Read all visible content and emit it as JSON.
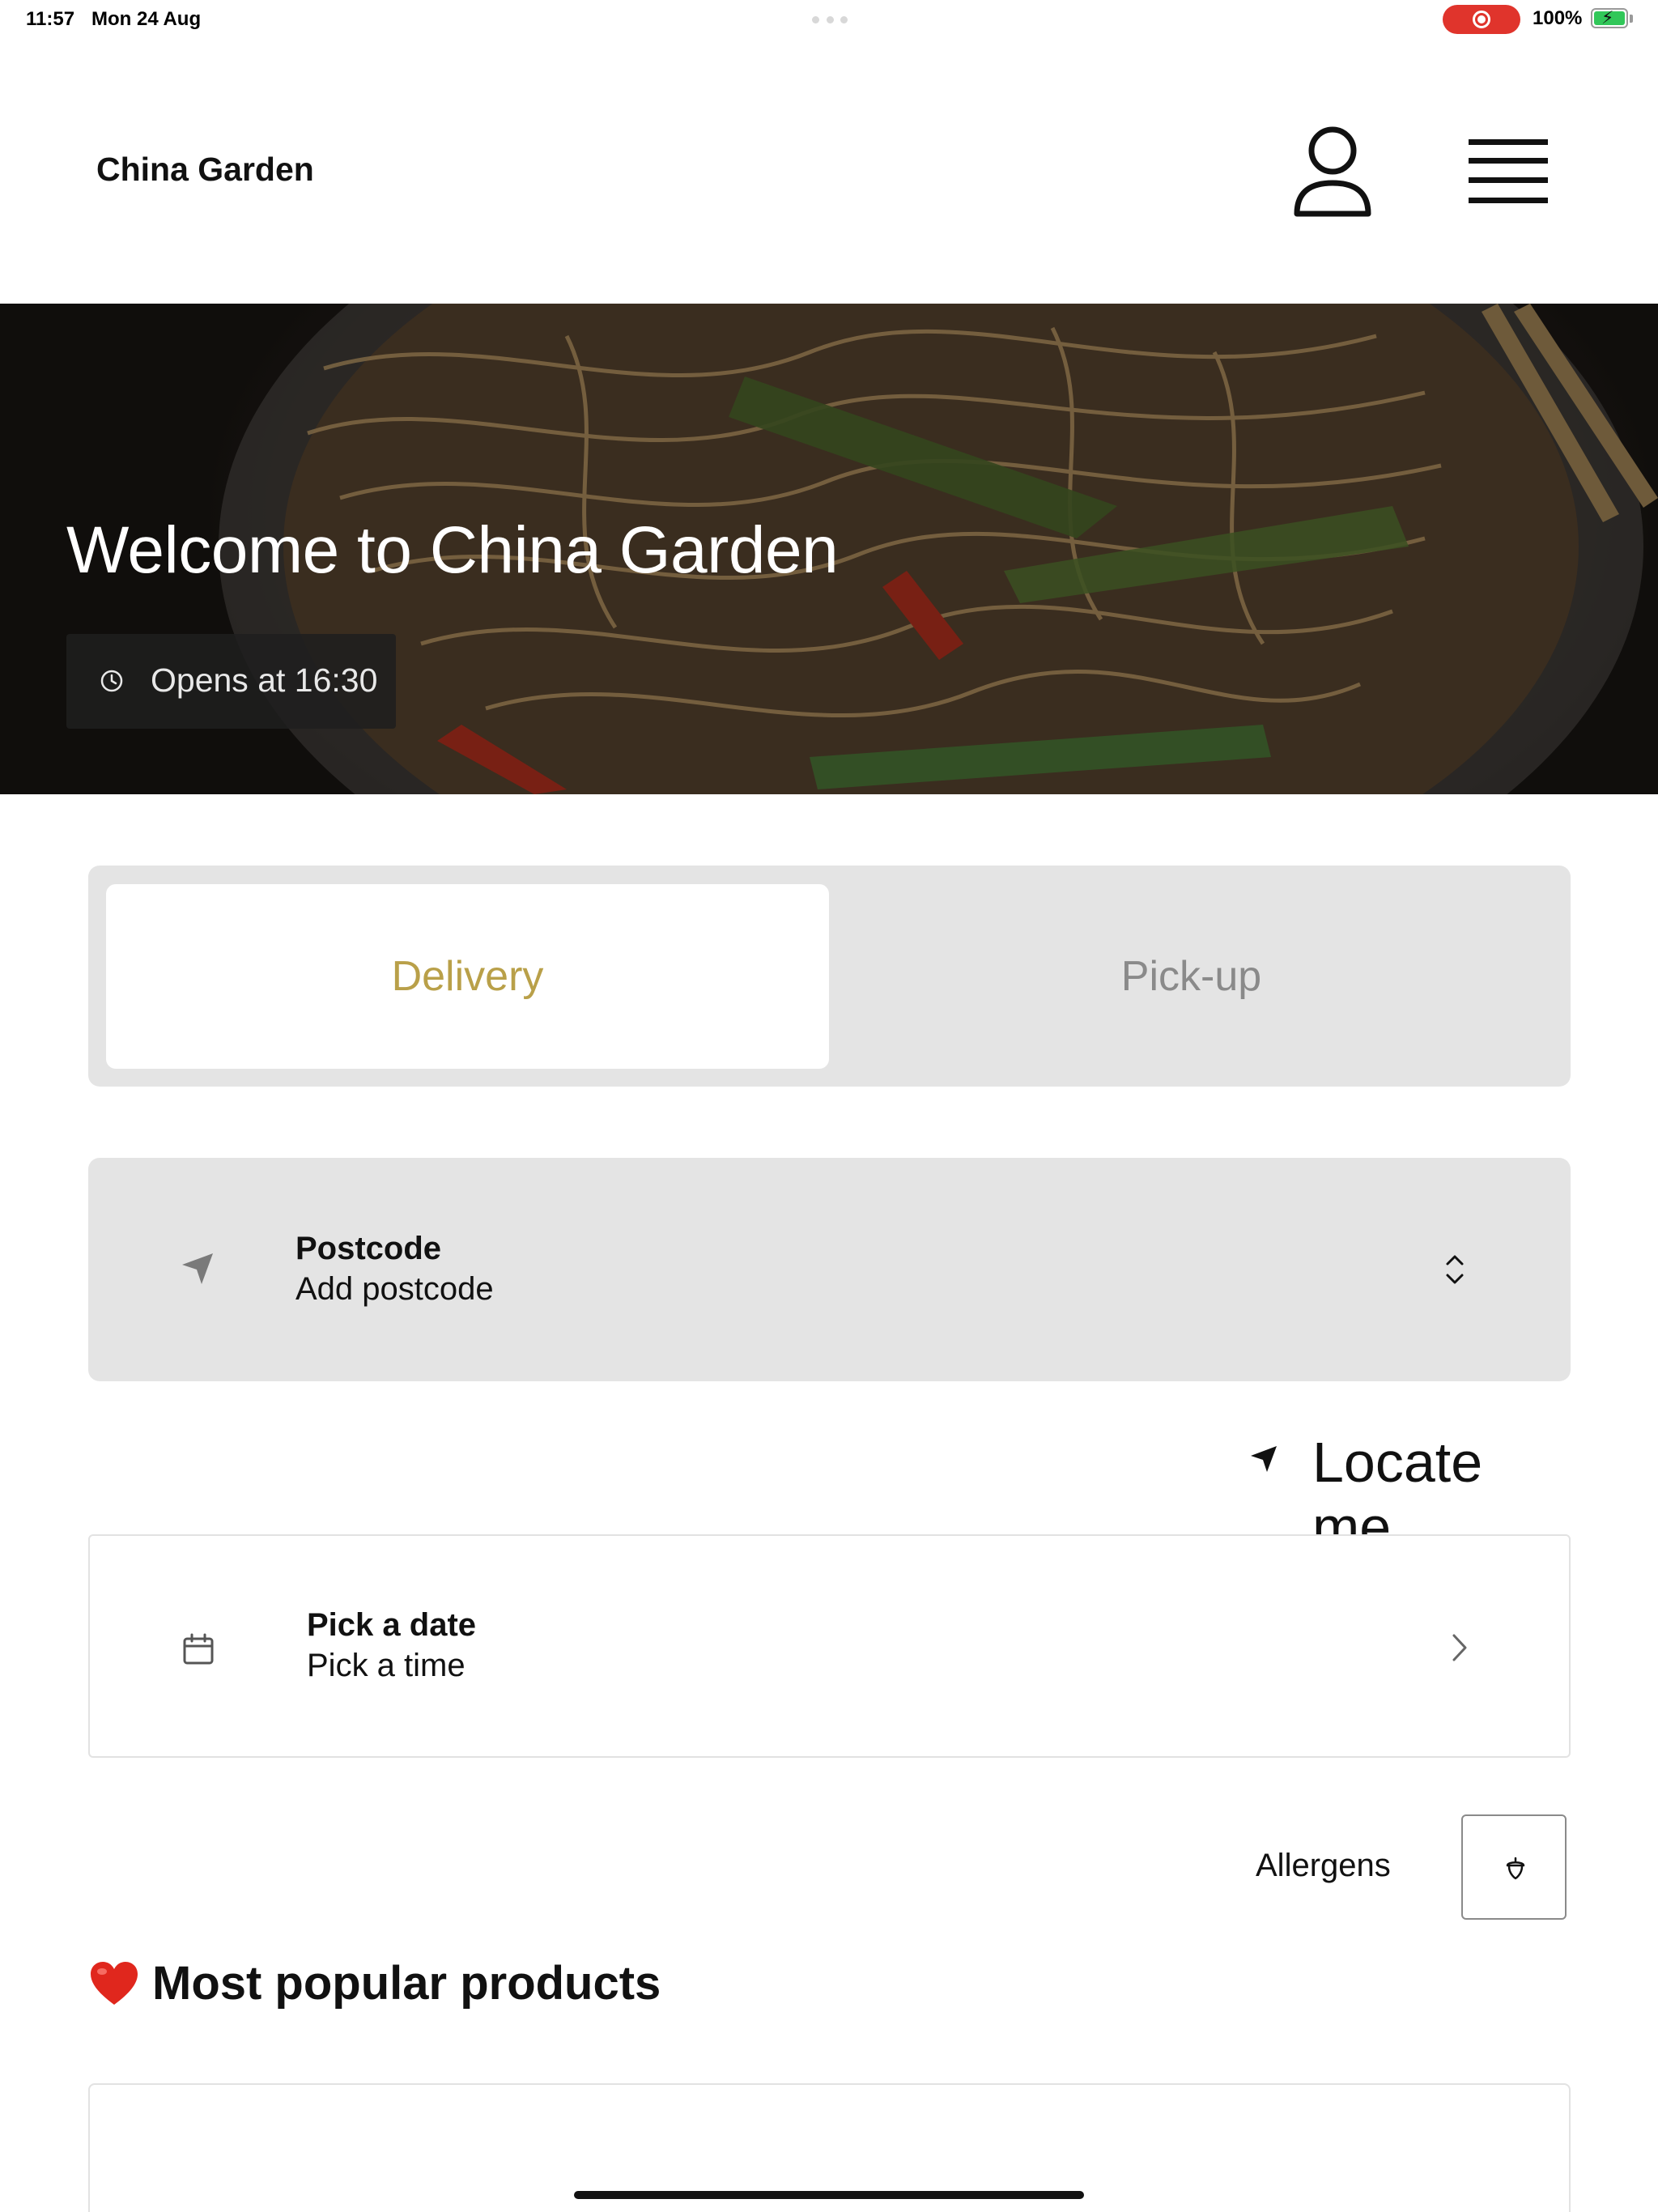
{
  "status_bar": {
    "time": "11:57",
    "date": "Mon 24 Aug",
    "battery": "100%"
  },
  "header": {
    "brand": "China Garden",
    "icons": [
      "user-icon",
      "hamburger-menu-icon"
    ]
  },
  "hero": {
    "title": "Welcome to China Garden",
    "hours": "Opens at 16:30",
    "hours_icon": "clock-icon"
  },
  "order_mode": {
    "options": [
      "Delivery",
      "Pick-up"
    ],
    "selected": "Delivery",
    "accent_color": "#b9a049"
  },
  "postcode": {
    "label": "Postcode",
    "value": "Add postcode",
    "icon": "location-arrow-icon"
  },
  "locate": {
    "label": "Locate me",
    "icon": "location-arrow-icon"
  },
  "schedule": {
    "date_label": "Pick a date",
    "time_label": "Pick a time",
    "icon": "calendar-icon"
  },
  "allergens": {
    "label": "Allergens",
    "icon": "acorn-icon"
  },
  "popular": {
    "icon": "heart-emoji",
    "title": "Most popular products"
  }
}
